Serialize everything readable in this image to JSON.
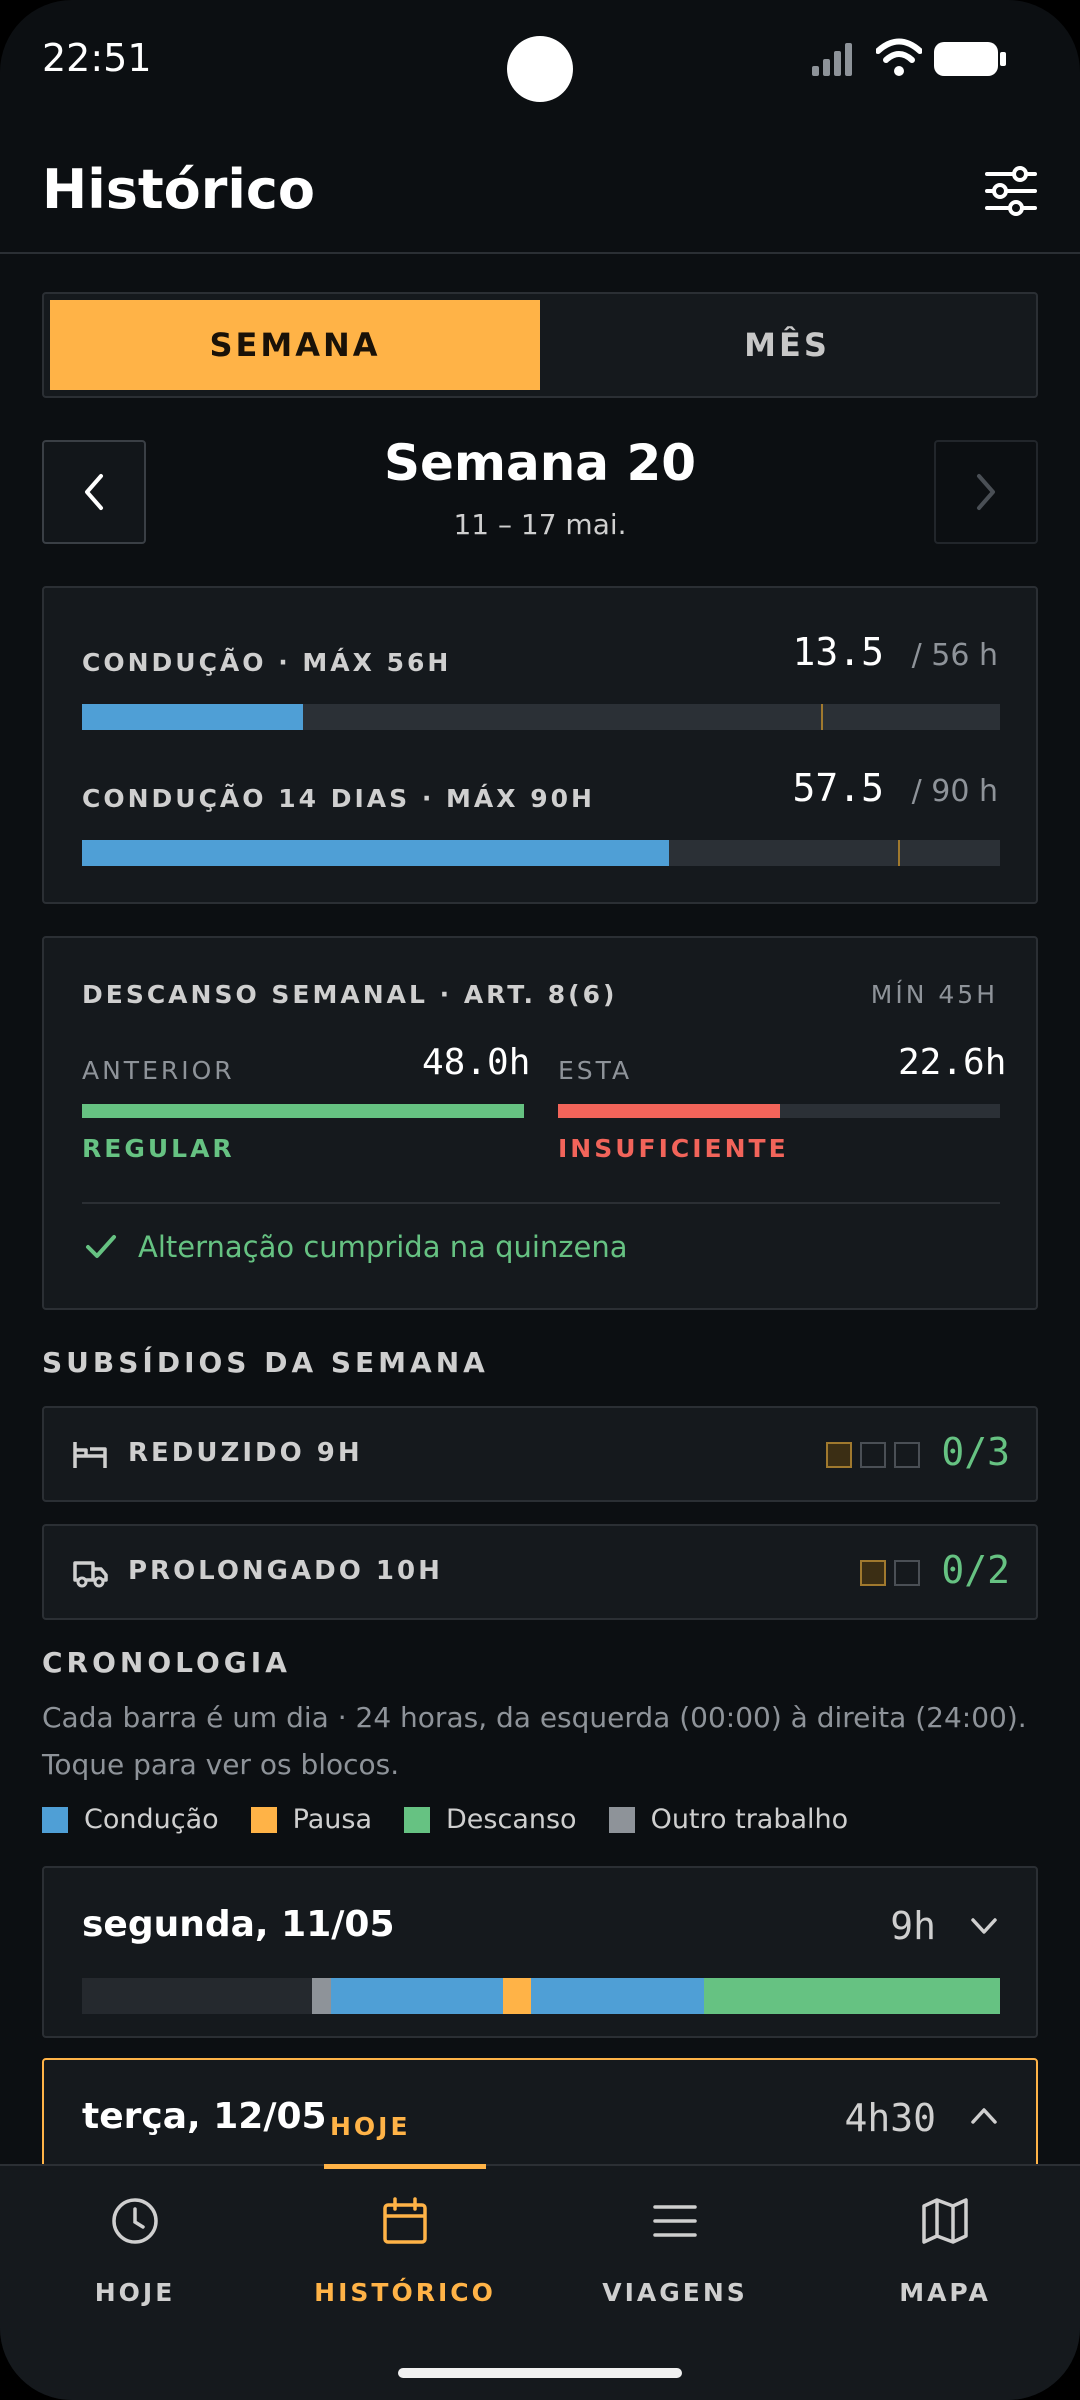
{
  "status_bar": {
    "time": "22:51"
  },
  "header": {
    "title": "Histórico"
  },
  "period_toggle": {
    "week_label": "SEMANA",
    "month_label": "MÊS",
    "selected": "week"
  },
  "week_nav": {
    "title": "Semana 20",
    "range": "11 – 17 mai."
  },
  "driving_limits": [
    {
      "label": "CONDUÇÃO · MÁX 56H",
      "value": "13.5",
      "max_text": "/ 56 h",
      "fraction": 0.241,
      "color": "#4f9fd6"
    },
    {
      "label": "CONDUÇÃO 14 DIAS · MÁX 90H",
      "value": "57.5",
      "max_text": "/ 90 h",
      "fraction": 0.639,
      "color": "#4f9fd6"
    }
  ],
  "weekly_rest": {
    "title": "DESCANSO SEMANAL · ART. 8(6)",
    "min_label": "MÍN 45H",
    "previous": {
      "label": "ANTERIOR",
      "value": "48.0h",
      "fraction": 1.0,
      "status": "REGULAR",
      "color": "#66c282"
    },
    "current": {
      "label": "ESTA",
      "value": "22.6h",
      "fraction": 0.502,
      "status": "INSUFICIENTE",
      "color": "#f2645a"
    },
    "note": "Alternação cumprida na quinzena"
  },
  "allowances": {
    "title": "SUBSÍDIOS DA SEMANA",
    "items": [
      {
        "label": "REDUZIDO 9H",
        "icon": "bed-icon",
        "used": 1,
        "total": 3,
        "count": "0/3"
      },
      {
        "label": "PROLONGADO 10H",
        "icon": "truck-icon",
        "used": 1,
        "total": 2,
        "count": "0/2"
      }
    ]
  },
  "timeline": {
    "title": "CRONOLOGIA",
    "description": "Cada barra é um dia · 24 horas, da esquerda (00:00) à direita (24:00). Toque para ver os blocos.",
    "legend": [
      {
        "label": "Condução",
        "color": "#4f9fd6"
      },
      {
        "label": "Pausa",
        "color": "#ffb347"
      },
      {
        "label": "Descanso",
        "color": "#66c282"
      },
      {
        "label": "Outro trabalho",
        "color": "#8e9399"
      }
    ],
    "days": [
      {
        "name": "segunda, 11/05",
        "hours": "9h",
        "expanded": false,
        "blocks": [
          {
            "type": "other",
            "start": 6.0,
            "end": 6.5,
            "color": "#8e9399"
          },
          {
            "type": "drive",
            "start": 6.5,
            "end": 11.0,
            "color": "#4f9fd6"
          },
          {
            "type": "pause",
            "start": 11.0,
            "end": 11.75,
            "color": "#ffb347"
          },
          {
            "type": "drive",
            "start": 11.75,
            "end": 16.25,
            "color": "#4f9fd6"
          },
          {
            "type": "rest",
            "start": 16.25,
            "end": 24.0,
            "color": "#66c282"
          }
        ]
      },
      {
        "name": "terça, 12/05",
        "badge": "HOJE",
        "hours": "4h30",
        "expanded": true
      }
    ]
  },
  "bottom_nav": {
    "tabs": [
      {
        "label": "HOJE",
        "icon": "clock-icon"
      },
      {
        "label": "HISTÓRICO",
        "icon": "calendar-icon",
        "active": true
      },
      {
        "label": "VIAGENS",
        "icon": "menu-icon"
      },
      {
        "label": "MAPA",
        "icon": "map-icon"
      }
    ]
  },
  "colors": {
    "accent": "#ffb347",
    "ok": "#66c282",
    "bad": "#f2645a",
    "drive": "#4f9fd6"
  }
}
